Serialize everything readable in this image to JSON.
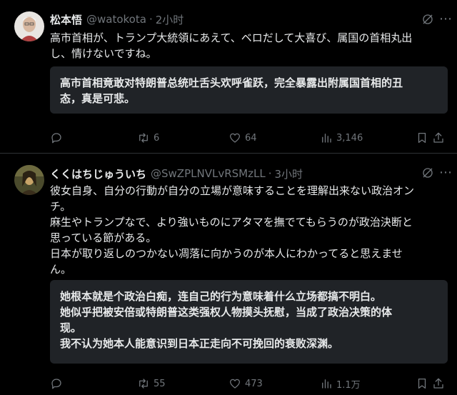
{
  "posts": [
    {
      "author_name": "松本悟",
      "handle": "@watokota",
      "separator": "·",
      "time": "2小时",
      "body_lines": [
        "高市首相が、トランプ大統領にあえて、ベロだして大喜び、属国の首相丸出",
        "し、情けないですね。"
      ],
      "translation_lines": [
        "高市首相竟敢对特朗普总统吐舌头欢呼雀跃，完全暴露出附属国首相的丑",
        "态，真是可悲。"
      ],
      "retweets": "6",
      "likes": "64",
      "views": "3,146"
    },
    {
      "author_name": "くくはちじゅういち",
      "handle": "@SwZPLNVLvRSMzLL",
      "separator": "·",
      "time": "3小时",
      "body_lines": [
        "彼女自身、自分の行動が自分の立場が意味することを理解出来ない政治オン",
        "チ。",
        "麻生やトランプなで、より強いものにアタマを撫でてもらうのが政治決断と",
        "思っている節がある。",
        "日本が取り返しのつかない凋落に向かうのが本人にわかってると思えませ",
        "ん。"
      ],
      "translation_lines": [
        "她根本就是个政治白痴，连自己的行为意味着什么立场都搞不明白。",
        "她似乎把被安倍或特朗普这类强权人物摸头抚慰，当成了政治决策的体",
        "现。",
        "我不认为她本人能意识到日本正走向不可挽回的衰败深渊。"
      ],
      "retweets": "55",
      "likes": "473",
      "views": "1.1万"
    }
  ],
  "icons": {
    "reply": "reply-icon",
    "retweet": "retweet-icon",
    "like": "like-icon",
    "views": "views-icon",
    "bookmark": "bookmark-icon",
    "share": "share-icon",
    "grok": "grok-icon",
    "more": "more-icon"
  },
  "colors": {
    "background": "#000000",
    "text": "#e7e9ea",
    "muted": "#71767b",
    "translation_box": "#202327",
    "divider": "#2f3336"
  }
}
